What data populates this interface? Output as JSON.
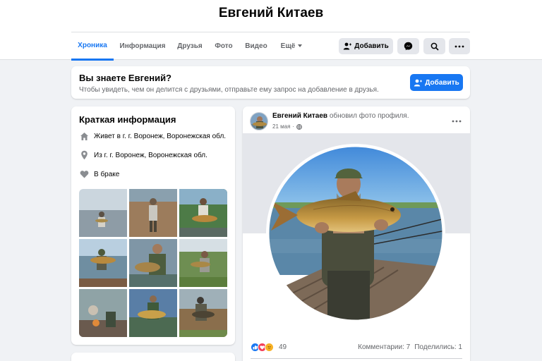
{
  "profile": {
    "name": "Евгений Китаев"
  },
  "nav": {
    "tabs": [
      {
        "label": "Хроника",
        "active": true
      },
      {
        "label": "Информация"
      },
      {
        "label": "Друзья"
      },
      {
        "label": "Фото"
      },
      {
        "label": "Видео"
      },
      {
        "label": "Ещё"
      }
    ],
    "add_friend_label": "Добавить"
  },
  "know": {
    "title": "Вы знаете Евгений?",
    "text": "Чтобы увидеть, чем он делится с друзьями, отправьте ему запрос на добавление в друзья.",
    "button_label": "Добавить"
  },
  "intro": {
    "title": "Краткая информация",
    "items": [
      {
        "icon": "home-icon",
        "text": "Живет в г. г. Воронеж, Воронежская обл."
      },
      {
        "icon": "location-pin-icon",
        "text": "Из г. г. Воронеж, Воронежская обл."
      },
      {
        "icon": "heart-icon",
        "text": "В браке"
      }
    ]
  },
  "post": {
    "author": "Евгений Китаев",
    "action": "обновил фото профиля.",
    "date": "21 мая",
    "reaction_count": "49",
    "comments": "Комментарии: 7",
    "shares": "Поделились: 1"
  },
  "colors": {
    "accent": "#1877f2",
    "page_bg": "#f0f2f5",
    "secondary_text": "#65676b",
    "button_gray": "#e4e6eb"
  }
}
